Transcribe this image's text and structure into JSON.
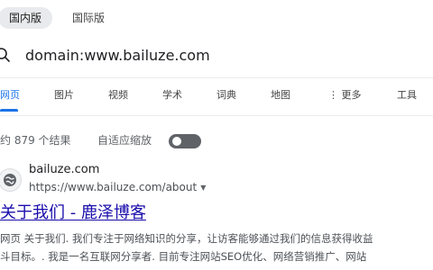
{
  "region_tabs": [
    {
      "label": "国内版",
      "active": true
    },
    {
      "label": "国际版",
      "active": false
    }
  ],
  "search": {
    "query": "domain:www.bailuze.com",
    "icon": "search-icon"
  },
  "nav_tabs": [
    {
      "label": "网页",
      "active": true
    },
    {
      "label": "图片",
      "active": false
    },
    {
      "label": "视频",
      "active": false
    },
    {
      "label": "学术",
      "active": false
    },
    {
      "label": "词典",
      "active": false
    },
    {
      "label": "地图",
      "active": false
    },
    {
      "label": "⋮ 更多",
      "active": false
    },
    {
      "label": "工具",
      "active": false
    }
  ],
  "results_info": {
    "count_text": "约 879 个结果",
    "safe_search_label": "自适应缩放",
    "safe_search_on": false
  },
  "result": {
    "site_name": "bailuze.com",
    "url": "https://www.bailuze.com/about",
    "title": "关于我们 - 鹿泽博客",
    "snippet_line1": "网页 关于我们. 我们专注于网络知识的分享，让访客能够通过我们的信息获得收益",
    "snippet_line2": "斗目标。. 我是一名互联网分享者. 目前专注网站SEO优化、网络营销推广、网站"
  },
  "colors": {
    "link": "#1a0dab",
    "accent": "#1a73e8",
    "muted": "#5f6368"
  }
}
